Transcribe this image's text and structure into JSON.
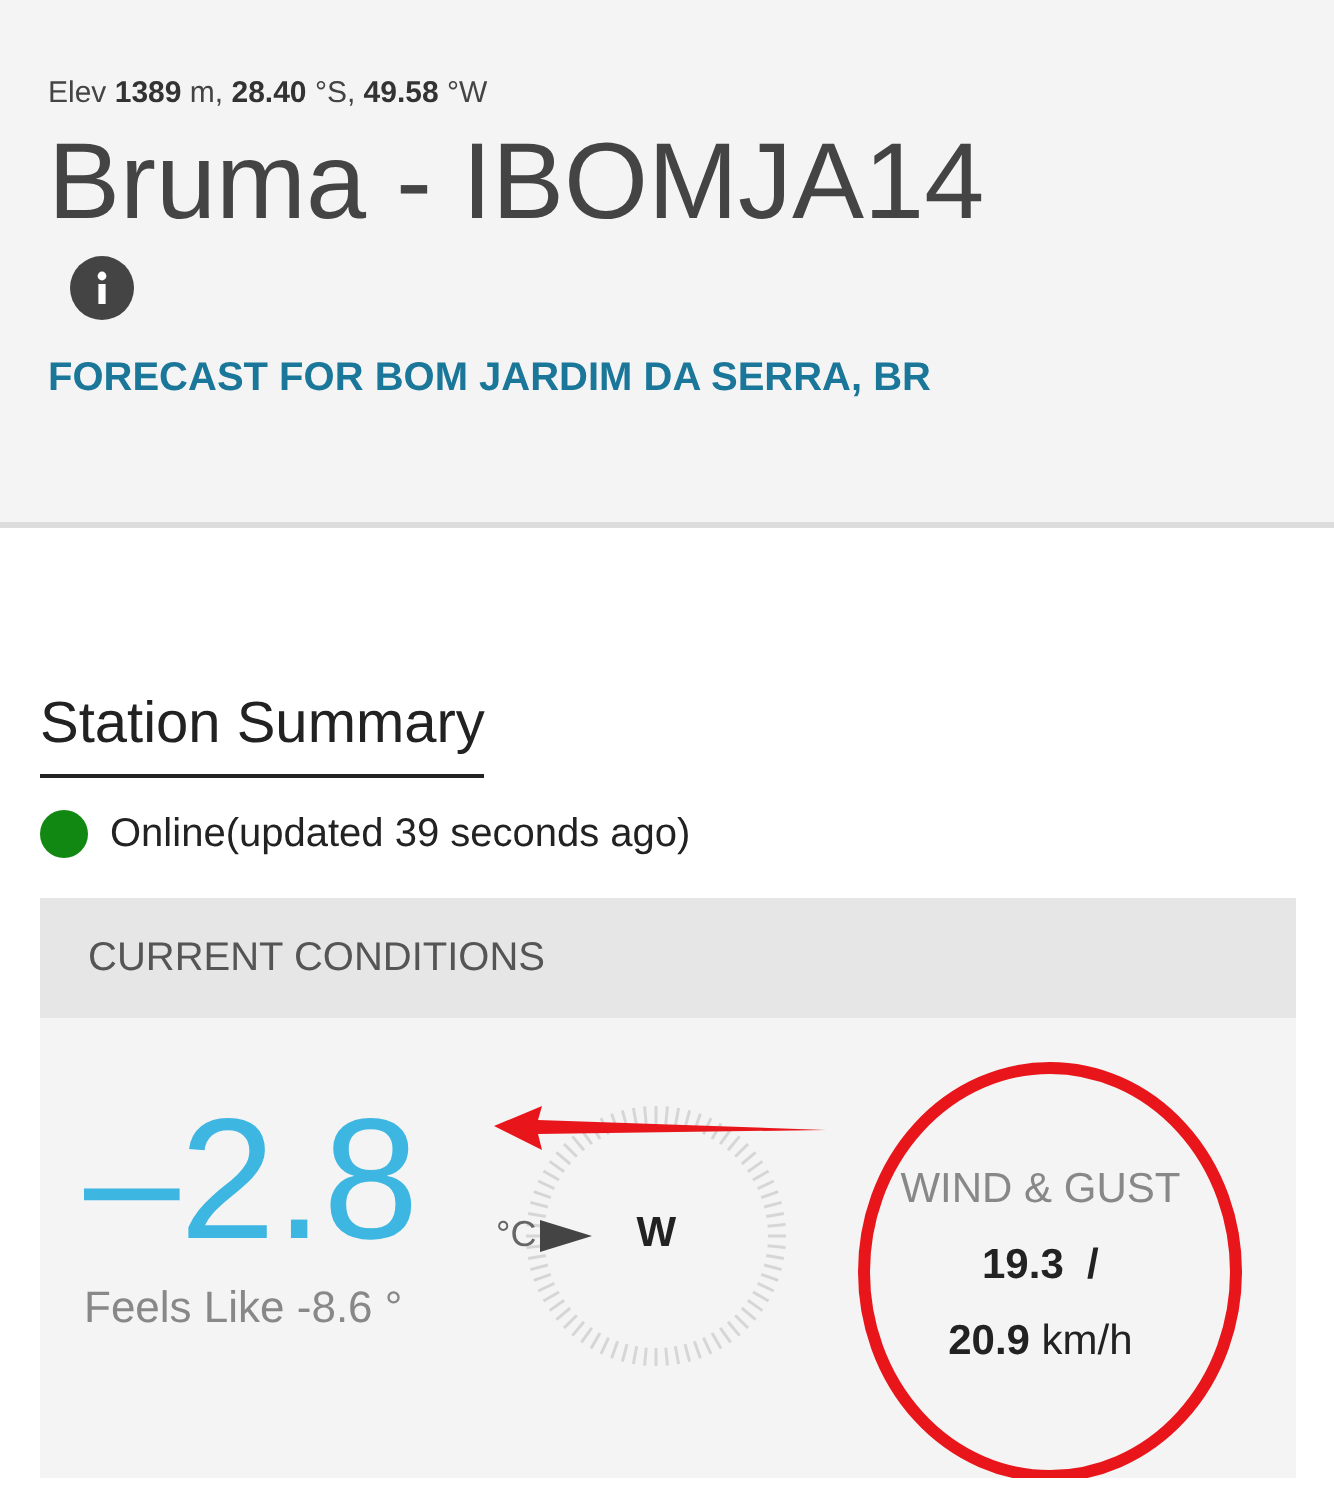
{
  "header": {
    "location": "Elev **1389** m, **28.40** °S, **49.58** °W",
    "title": "Bruma - IBOMJA14",
    "forecast_link": "FORECAST FOR BOM JARDIM DA SERRA, BR"
  },
  "summary": {
    "title": "Station Summary",
    "status": {
      "text": "Online(updated 39 seconds ago)",
      "color": "#118811"
    }
  },
  "current_conditions": {
    "heading": "CURRENT CONDITIONS",
    "temperature": "–2.8",
    "temperature_unit": "°C",
    "feels_like": "Feels Like -8.6 °",
    "wind_direction": "W",
    "wind_label": "WIND & GUST",
    "wind_speed": "19.3",
    "wind_separator": "/",
    "gust_speed": "20.9",
    "speed_unit": "km/h"
  },
  "annotations": {
    "arrow": true,
    "circle": true
  }
}
